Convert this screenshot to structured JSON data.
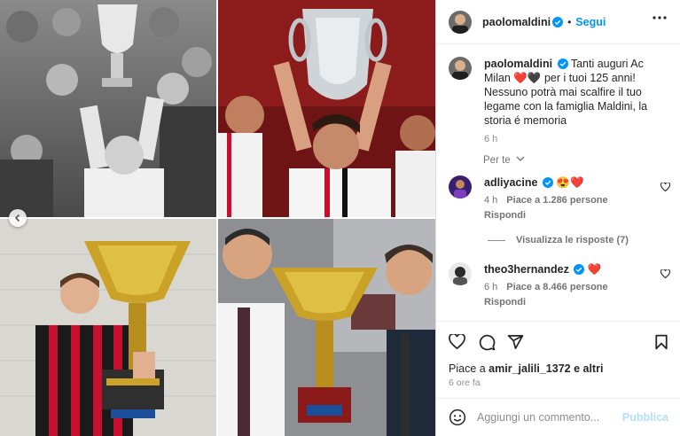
{
  "post": {
    "author": "paolomaldini",
    "follow_label": "Segui",
    "separator": "•",
    "caption": "Tanti auguri Ac Milan ❤️🖤 per i tuoi 125 anni! Nessuno potrà mai scalfire il tuo legame con la famiglia Maldini, la storia é memoria",
    "caption_time": "6 h",
    "translate_label": "Per te"
  },
  "comments": [
    {
      "user": "adliyacine",
      "text": "😍❤️",
      "time": "4 h",
      "likes": "Piace a 1.286 persone",
      "reply_label": "Rispondi",
      "view_replies": "Visualizza le risposte (7)"
    },
    {
      "user": "theo3hernandez",
      "text": "❤️",
      "time": "6 h",
      "likes": "Piace a 8.466 persone",
      "reply_label": "Rispondi"
    }
  ],
  "likes_line": {
    "prefix": "Piace a ",
    "user": "amir_jalili_1372",
    "suffix": " e altri"
  },
  "post_age": "6 ore fa",
  "composer": {
    "placeholder": "Aggiungi un commento...",
    "publish_label": "Pubblica"
  },
  "icons": {
    "verified": "verified-badge-icon",
    "more": "more-options-icon",
    "like": "heart-icon",
    "comment": "comment-icon",
    "share": "share-icon",
    "save": "bookmark-icon",
    "emoji": "emoji-icon",
    "prev": "chevron-left-icon"
  },
  "colors": {
    "accent": "#0095f6",
    "verified": "#0095f6",
    "publish_disabled": "#b2dffc",
    "milan_red": "#c8102e"
  }
}
